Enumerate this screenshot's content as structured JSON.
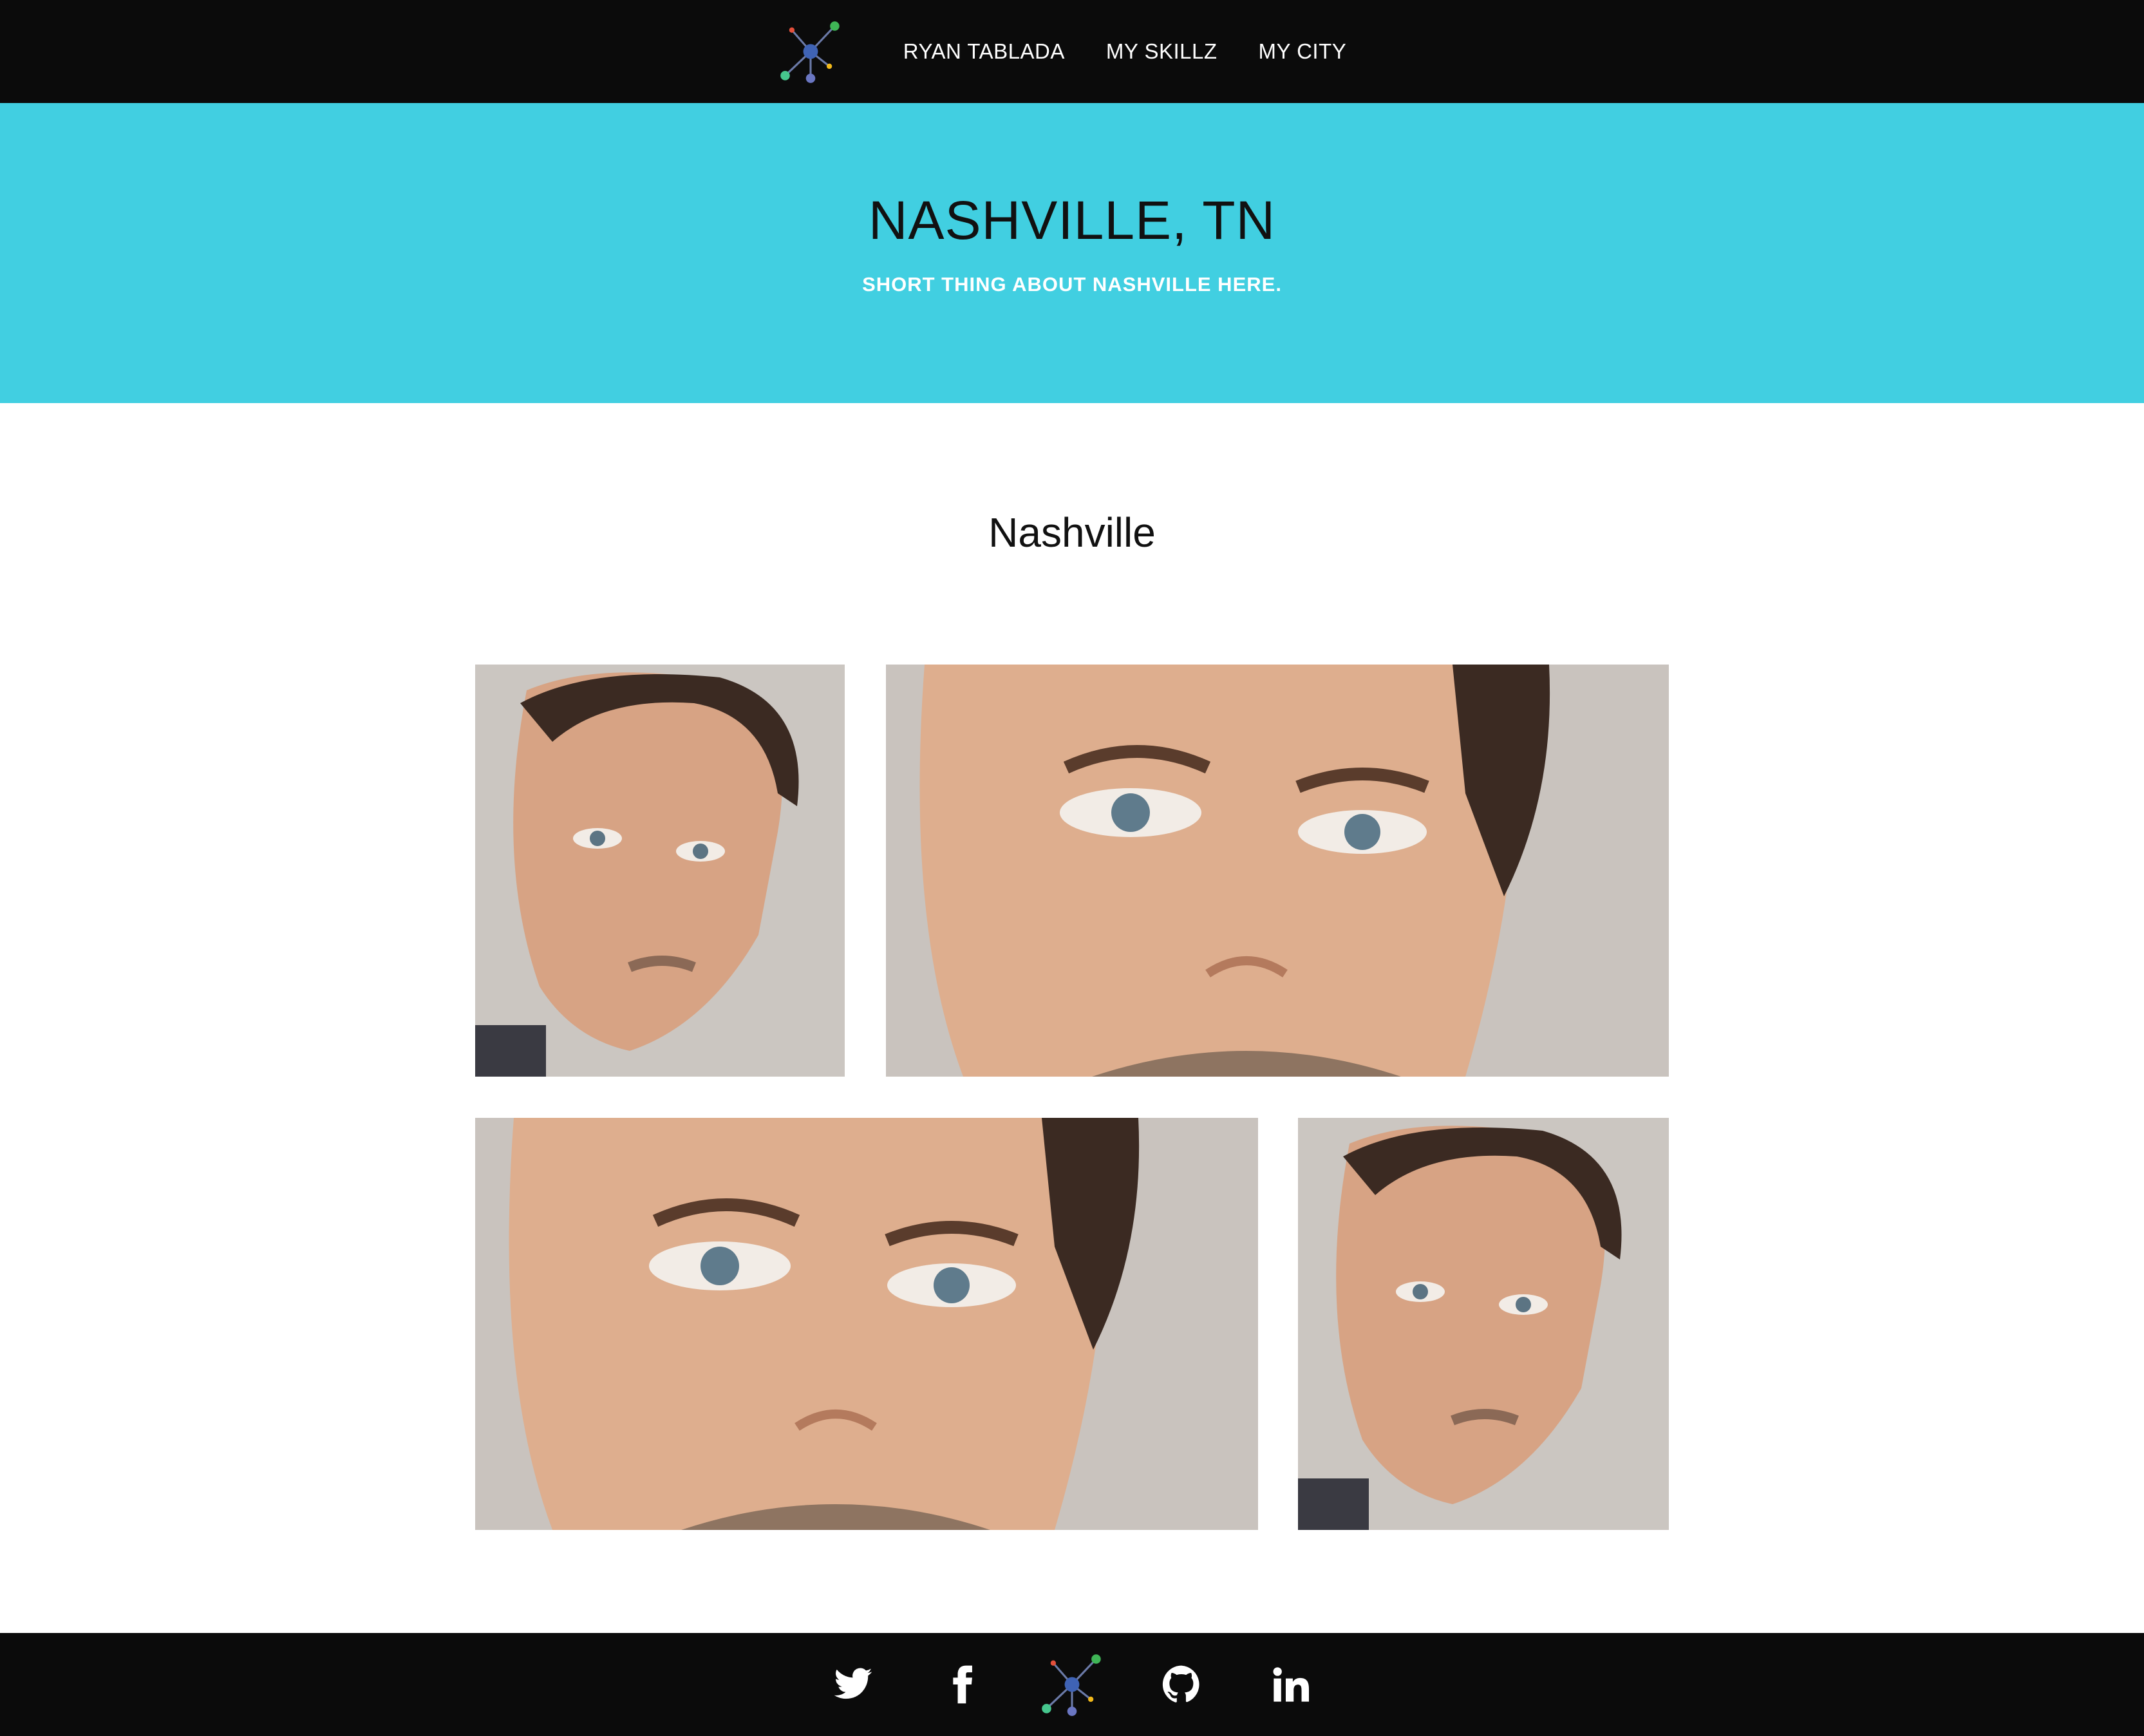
{
  "nav": {
    "logo_icon": "molecule-logo-icon",
    "links": [
      {
        "label": "RYAN TABLADA"
      },
      {
        "label": "MY SKILLZ"
      },
      {
        "label": "MY CITY"
      }
    ]
  },
  "hero": {
    "title": "NASHVILLE, TN",
    "subtitle": "SHORT THING ABOUT NASHVILLE HERE.",
    "background_color": "#41cfe1"
  },
  "section": {
    "title": "Nashville"
  },
  "gallery": {
    "photos": [
      {
        "icon": "portrait-photo"
      },
      {
        "icon": "closeup-face-photo"
      },
      {
        "icon": "closeup-face-photo"
      },
      {
        "icon": "portrait-photo"
      }
    ]
  },
  "footer": {
    "icons": [
      "twitter-icon",
      "facebook-icon",
      "molecule-logo-icon",
      "github-icon",
      "linkedin-icon"
    ],
    "background_color": "#0b0b0b"
  }
}
